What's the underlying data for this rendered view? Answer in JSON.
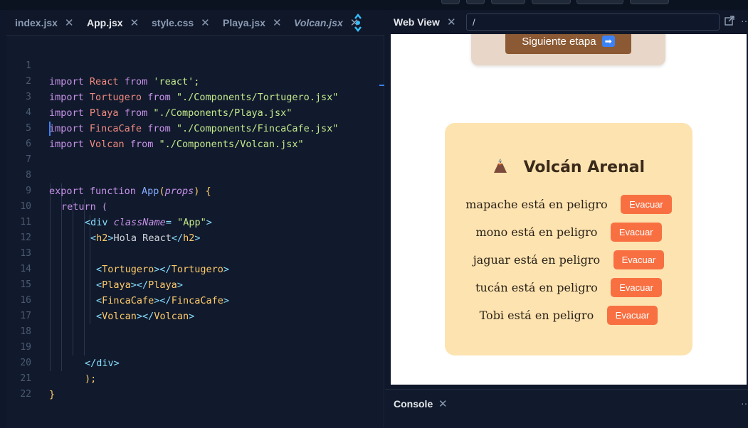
{
  "editor": {
    "tabs": [
      {
        "label": "index.jsx",
        "active": false
      },
      {
        "label": "App.jsx",
        "active": true
      },
      {
        "label": "style.css",
        "active": false
      },
      {
        "label": "Playa.jsx",
        "active": false
      },
      {
        "label": "Volcan.jsx",
        "active": false
      }
    ],
    "close_glyph": "✕",
    "line_numbers": [
      "1",
      "2",
      "3",
      "4",
      "5",
      "6",
      "7",
      "8",
      "9",
      "10",
      "11",
      "12",
      "13",
      "14",
      "15",
      "16",
      "17",
      "18",
      "19",
      "20",
      "21",
      "22"
    ],
    "code": {
      "l1": [
        "import",
        " React ",
        "from",
        " 'react';"
      ],
      "l2": [
        "import",
        " Tortugero ",
        "from",
        " \"./Components/Tortugero.jsx\""
      ],
      "l3": [
        "import",
        " Playa ",
        "from",
        " \"./Components/Playa.jsx\""
      ],
      "l4": [
        "import",
        " FincaCafe ",
        "from",
        " \"./Components/FincaCafe.jsx\""
      ],
      "l5": [
        "import",
        " Volcan ",
        "from",
        " \"./Components/Volcan.jsx\""
      ],
      "l8": [
        "export function ",
        "App",
        "(",
        "props",
        ") {"
      ],
      "l9": [
        "return (",
        ""
      ],
      "l10": [
        "<",
        "div",
        " className",
        "= ",
        "\"App\"",
        ">"
      ],
      "l11": [
        "<",
        "h2",
        ">",
        "Hola React",
        "</",
        "h2",
        ">"
      ],
      "l13": [
        "<",
        "Tortugero",
        "></",
        "Tortugero",
        ">"
      ],
      "l14": [
        "<",
        "Playa",
        "></",
        "Playa",
        ">"
      ],
      "l15": [
        "<",
        "FincaCafe",
        "></",
        "FincaCafe",
        ">"
      ],
      "l16": [
        "<",
        "Volcan",
        "></",
        "Volcan",
        ">"
      ],
      "l19": [
        "</",
        "div",
        ">"
      ],
      "l20": [
        ");"
      ],
      "l21": [
        "}"
      ]
    }
  },
  "webview": {
    "title": "Web View",
    "url": "/",
    "next_button": "Siguiente etapa",
    "next_arrow": "➡",
    "volcano": {
      "icon": "volcano-emoji",
      "title": "Volcán Arenal",
      "animals": [
        {
          "message": "mapache está en peligro",
          "button": "Evacuar"
        },
        {
          "message": "mono está en peligro",
          "button": "Evacuar"
        },
        {
          "message": "jaguar está en peligro",
          "button": "Evacuar"
        },
        {
          "message": "tucán está en peligro",
          "button": "Evacuar"
        },
        {
          "message": "Tobi está en peligro",
          "button": "Evacuar"
        }
      ]
    }
  },
  "console": {
    "title": "Console"
  },
  "colors": {
    "background": "#0f172a",
    "card": "#fde3b0",
    "evacuate": "#f87042",
    "next_button": "#8b5a34"
  }
}
